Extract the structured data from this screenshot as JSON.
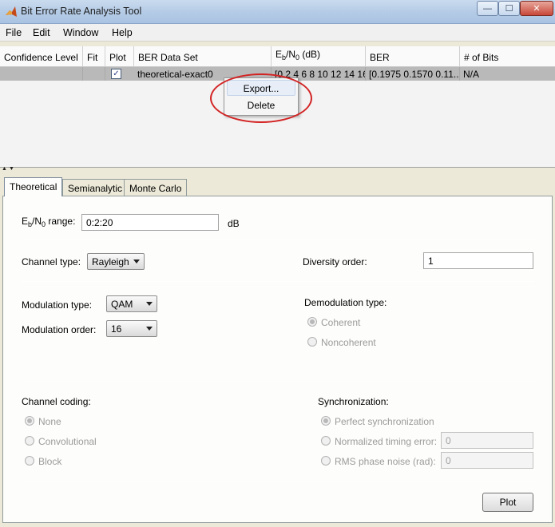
{
  "window": {
    "title": "Bit Error Rate Analysis Tool",
    "controls": {
      "minimize": "—",
      "maximize": "☐",
      "close": "✕"
    }
  },
  "menu": [
    "File",
    "Edit",
    "Window",
    "Help"
  ],
  "table": {
    "headers": {
      "confidence": "Confidence Level",
      "fit": "Fit",
      "plot": "Plot",
      "dataset": "BER Data Set",
      "ebno_prefix": "E",
      "ebno_sub_b": "b",
      "ebno_mid": "/N",
      "ebno_sub_0": "0",
      "ebno_suffix": " (dB)",
      "ber": "BER",
      "bits": "# of Bits"
    },
    "row": {
      "confidence": "",
      "fit": "",
      "plot_checked": true,
      "check_glyph": "✓",
      "dataset": "theoretical-exact0",
      "ebno": "[0 2 4 6 8 10 12 14 16...",
      "ber": "[0.1975  0.1570  0.11...",
      "bits": "N/A"
    }
  },
  "context_menu": {
    "export": "Export...",
    "delete": "Delete"
  },
  "splitter": {
    "up": "▲",
    "down": "▼"
  },
  "tabs": [
    "Theoretical",
    "Semianalytic",
    "Monte Carlo"
  ],
  "theoretical": {
    "ebno_label_prefix": "E",
    "ebno_label_sub_b": "b",
    "ebno_label_mid": "/N",
    "ebno_label_sub_0": "0",
    "ebno_label_suffix": " range:",
    "ebno_value": "0:2:20",
    "ebno_unit": "dB",
    "channel_type_label": "Channel type:",
    "channel_type_value": "Rayleigh",
    "diversity_label": "Diversity order:",
    "diversity_value": "1",
    "modulation_type_label": "Modulation type:",
    "modulation_type_value": "QAM",
    "modulation_order_label": "Modulation order:",
    "modulation_order_value": "16",
    "demod_label": "Demodulation type:",
    "demod_options": [
      "Coherent",
      "Noncoherent"
    ],
    "coding_label": "Channel coding:",
    "coding_options": [
      "None",
      "Convolutional",
      "Block"
    ],
    "sync_label": "Synchronization:",
    "sync_options": [
      "Perfect synchronization",
      "Normalized timing error:",
      "RMS phase noise (rad):"
    ],
    "timing_error_value": "0",
    "phase_noise_value": "0",
    "plot_button": "Plot"
  },
  "colors": {
    "highlight_row": "#b9b9b9",
    "annotation_ellipse": "#d32323"
  }
}
